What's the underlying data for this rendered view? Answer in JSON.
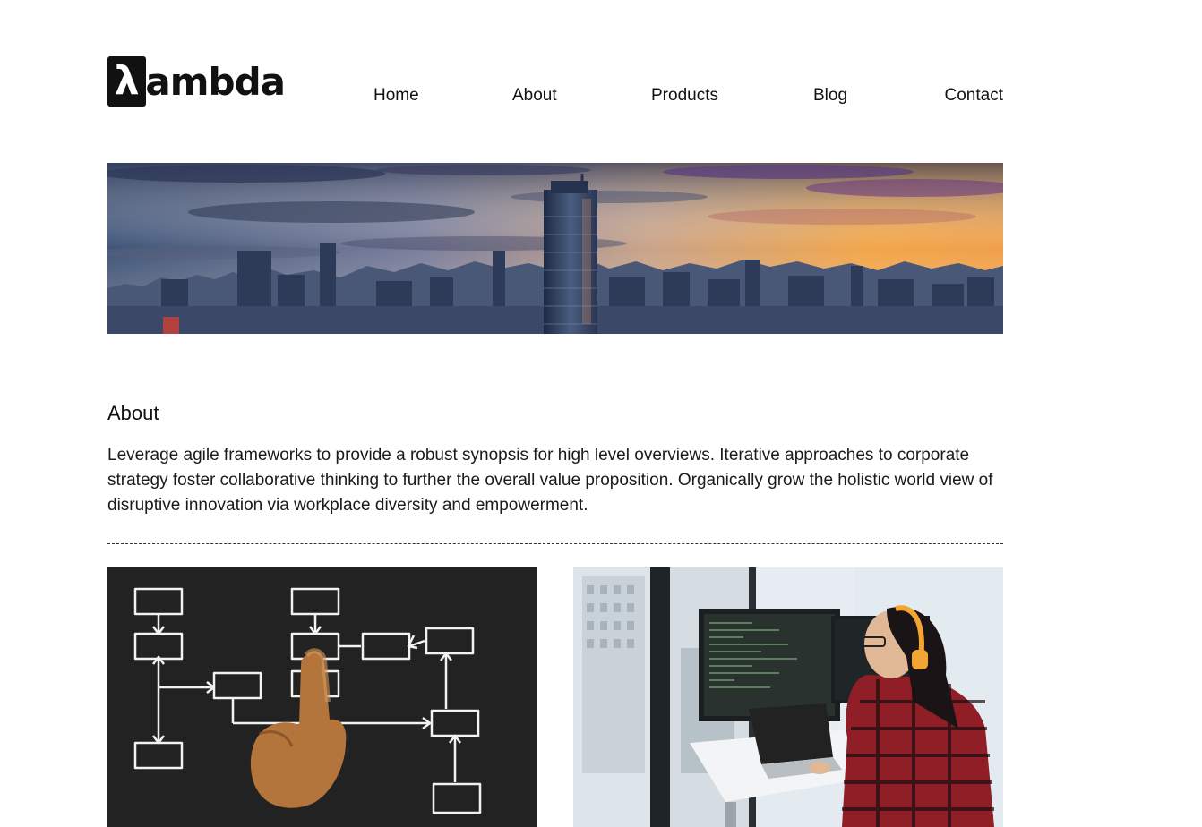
{
  "brand": {
    "logo_mark": "λ",
    "logo_text": "ambda"
  },
  "nav": {
    "items": [
      {
        "label": "Home"
      },
      {
        "label": "About"
      },
      {
        "label": "Products"
      },
      {
        "label": "Blog"
      },
      {
        "label": "Contact"
      }
    ]
  },
  "hero": {
    "image": "city-skyline-sunset"
  },
  "about": {
    "title": "About",
    "text": "Leverage agile frameworks to provide a robust synopsis for high level overviews. Iterative approaches to corporate strategy foster collaborative thinking to further the overall value proposition. Organically grow the holistic world view of disruptive innovation via workplace diversity and empowerment."
  },
  "cards": [
    {
      "image": "chalkboard-flowchart-hand"
    },
    {
      "image": "developer-at-monitors"
    }
  ],
  "colors": {
    "text": "#111111",
    "background": "#ffffff",
    "chalkboard": "#222222"
  }
}
